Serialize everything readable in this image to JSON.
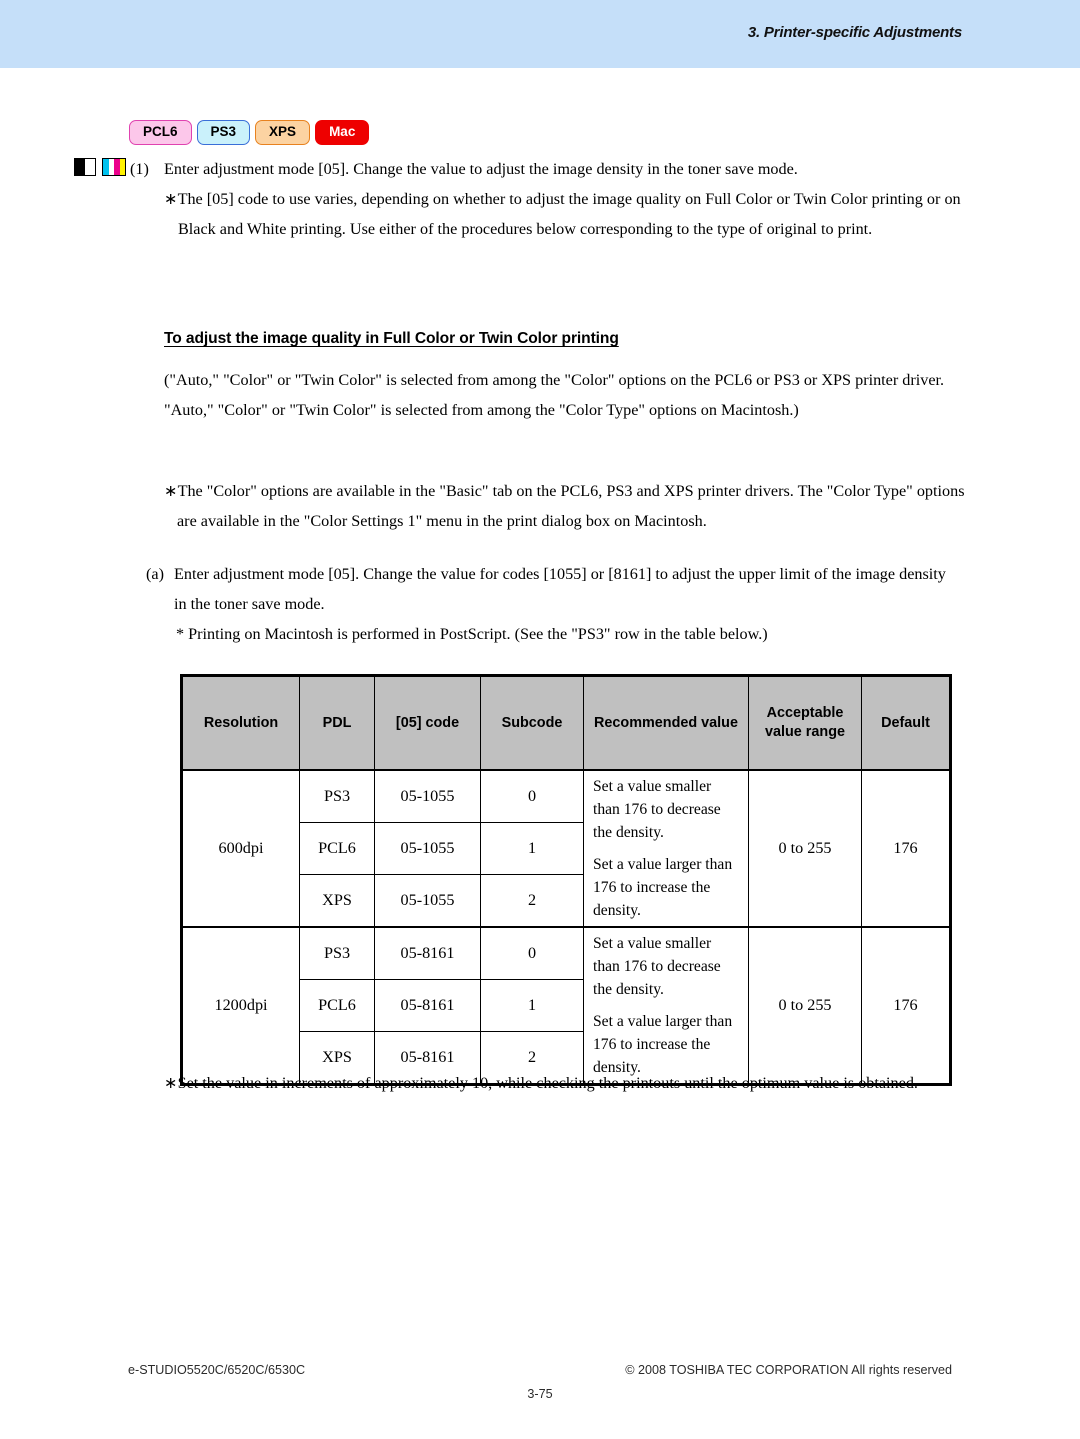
{
  "header": {
    "chapter_title": "3. Printer-specific Adjustments"
  },
  "badges": [
    {
      "label": "PCL6",
      "name": "badge-pcl6"
    },
    {
      "label": "PS3",
      "name": "badge-ps3"
    },
    {
      "label": "XPS",
      "name": "badge-xps"
    },
    {
      "label": "Mac",
      "name": "badge-mac"
    }
  ],
  "icons": {
    "black_white": "black-white-mode-icon",
    "full_color": "full-color-mode-icon"
  },
  "body": {
    "step1_label": "(1)",
    "step1_text": "Enter adjustment mode [05].  Change the value to adjust the image density in the toner save mode.",
    "note1_text": "∗The [05] code to use varies, depending on whether to adjust the image quality on Full Color or Twin Color printing or on Black and White printing.  Use either of the procedures below corresponding to the type of original to print.",
    "section_heading": "To adjust the image quality in Full Color or Twin Color printing",
    "body2_text": "(\"Auto,\" \"Color\" or \"Twin Color\" is selected from among the \"Color\" options on the PCL6 or PS3 or XPS printer driver.  \"Auto,\" \"Color\" or \"Twin Color\" is selected from among the \"Color Type\" options on Macintosh.)",
    "note2_text": "∗The \"Color\" options are available in the \"Basic\" tab on the PCL6, PS3 and XPS printer drivers.  The \"Color Type\" options are available in the \"Color Settings 1\" menu in the print dialog box on Macintosh.",
    "stepa_label": "(a)",
    "stepa_text": "Enter adjustment mode [05].  Change the value for codes [1055] or [8161] to adjust the upper limit of the image density in the toner save mode.",
    "note3_text": "* Printing on Macintosh is performed in PostScript.  (See the \"PS3\" row in the table below.)",
    "note4_text": "∗Set the value in increments of approximately 10, while checking the printouts until the optimum value is obtained."
  },
  "table": {
    "headers": [
      "Resolution",
      "PDL",
      "[05] code",
      "Subcode",
      "Recommended value",
      "Acceptable value range",
      "Default"
    ],
    "recommended_line1": "Set a value smaller than 176 to decrease the density.",
    "recommended_line2": "Set a value larger than 176 to increase the density.",
    "groups": [
      {
        "resolution": "600dpi",
        "acceptable": "0 to 255",
        "default": "176",
        "rows": [
          {
            "pdl": "PS3",
            "code": "05-1055",
            "subcode": "0"
          },
          {
            "pdl": "PCL6",
            "code": "05-1055",
            "subcode": "1"
          },
          {
            "pdl": "XPS",
            "code": "05-1055",
            "subcode": "2"
          }
        ]
      },
      {
        "resolution": "1200dpi",
        "acceptable": "0 to 255",
        "default": "176",
        "rows": [
          {
            "pdl": "PS3",
            "code": "05-8161",
            "subcode": "0"
          },
          {
            "pdl": "PCL6",
            "code": "05-8161",
            "subcode": "1"
          },
          {
            "pdl": "XPS",
            "code": "05-8161",
            "subcode": "2"
          }
        ]
      }
    ]
  },
  "footer": {
    "model": "e-STUDIO5520C/6520C/6530C",
    "copyright": "© 2008 TOSHIBA TEC CORPORATION All rights reserved",
    "page_number": "3-75"
  },
  "colors": {
    "header_band": "#c5dff9",
    "table_header": "#c0c0c0",
    "badge_pcl6": "#fcc7ea",
    "badge_ps3": "#caf1fb",
    "badge_xps": "#fcd3a2",
    "badge_mac": "#ee0000"
  }
}
